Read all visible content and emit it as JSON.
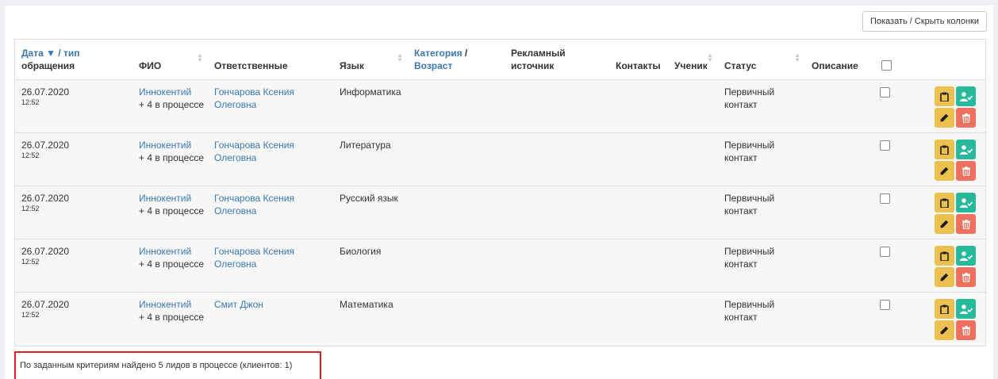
{
  "toolbar": {
    "toggle_columns_label": "Показать / Скрыть колонки"
  },
  "table": {
    "headers": {
      "date_link": "Дата ▼ / тип",
      "date_rest": "обращения",
      "fio": "ФИО",
      "responsible": "Ответственные",
      "language": "Язык",
      "category_link1": "Категория",
      "category_sep": " /",
      "category_link2": "Возраст",
      "source_line1": "Рекламный",
      "source_line2": "источник",
      "contacts": "Контакты",
      "student": "Ученик",
      "status": "Статус",
      "description": "Описание"
    },
    "rows": [
      {
        "date": "26.07.2020",
        "time": "12:52",
        "name": "Иннокентий",
        "process": "+ 4 в процессе",
        "resp_line1": "Гончарова Ксения",
        "resp_line2": "Олеговна",
        "language": "Информатика",
        "status_line1": "Первичный",
        "status_line2": "контакт"
      },
      {
        "date": "26.07.2020",
        "time": "12:52",
        "name": "Иннокентий",
        "process": "+ 4 в процессе",
        "resp_line1": "Гончарова Ксения",
        "resp_line2": "Олеговна",
        "language": "Литература",
        "status_line1": "Первичный",
        "status_line2": "контакт"
      },
      {
        "date": "26.07.2020",
        "time": "12:52",
        "name": "Иннокентий",
        "process": "+ 4 в процессе",
        "resp_line1": "Гончарова Ксения",
        "resp_line2": "Олеговна",
        "language": "Русский язык",
        "status_line1": "Первичный",
        "status_line2": "контакт"
      },
      {
        "date": "26.07.2020",
        "time": "12:52",
        "name": "Иннокентий",
        "process": "+ 4 в процессе",
        "resp_line1": "Гончарова Ксения",
        "resp_line2": "Олеговна",
        "language": "Биология",
        "status_line1": "Первичный",
        "status_line2": "контакт"
      },
      {
        "date": "26.07.2020",
        "time": "12:52",
        "name": "Иннокентий",
        "process": "+ 4 в процессе",
        "resp_line1": "Смит Джон",
        "resp_line2": "",
        "language": "Математика",
        "status_line1": "Первичный",
        "status_line2": "контакт"
      }
    ]
  },
  "summary": {
    "text": "По заданным критериям найдено 5 лидов в процессе (клиентов: 1)"
  },
  "colors": {
    "link": "#3a78b5",
    "yellow": "#ebc04f",
    "teal": "#26b99a",
    "red": "#f0705f",
    "highlight": "#e01b1b"
  }
}
